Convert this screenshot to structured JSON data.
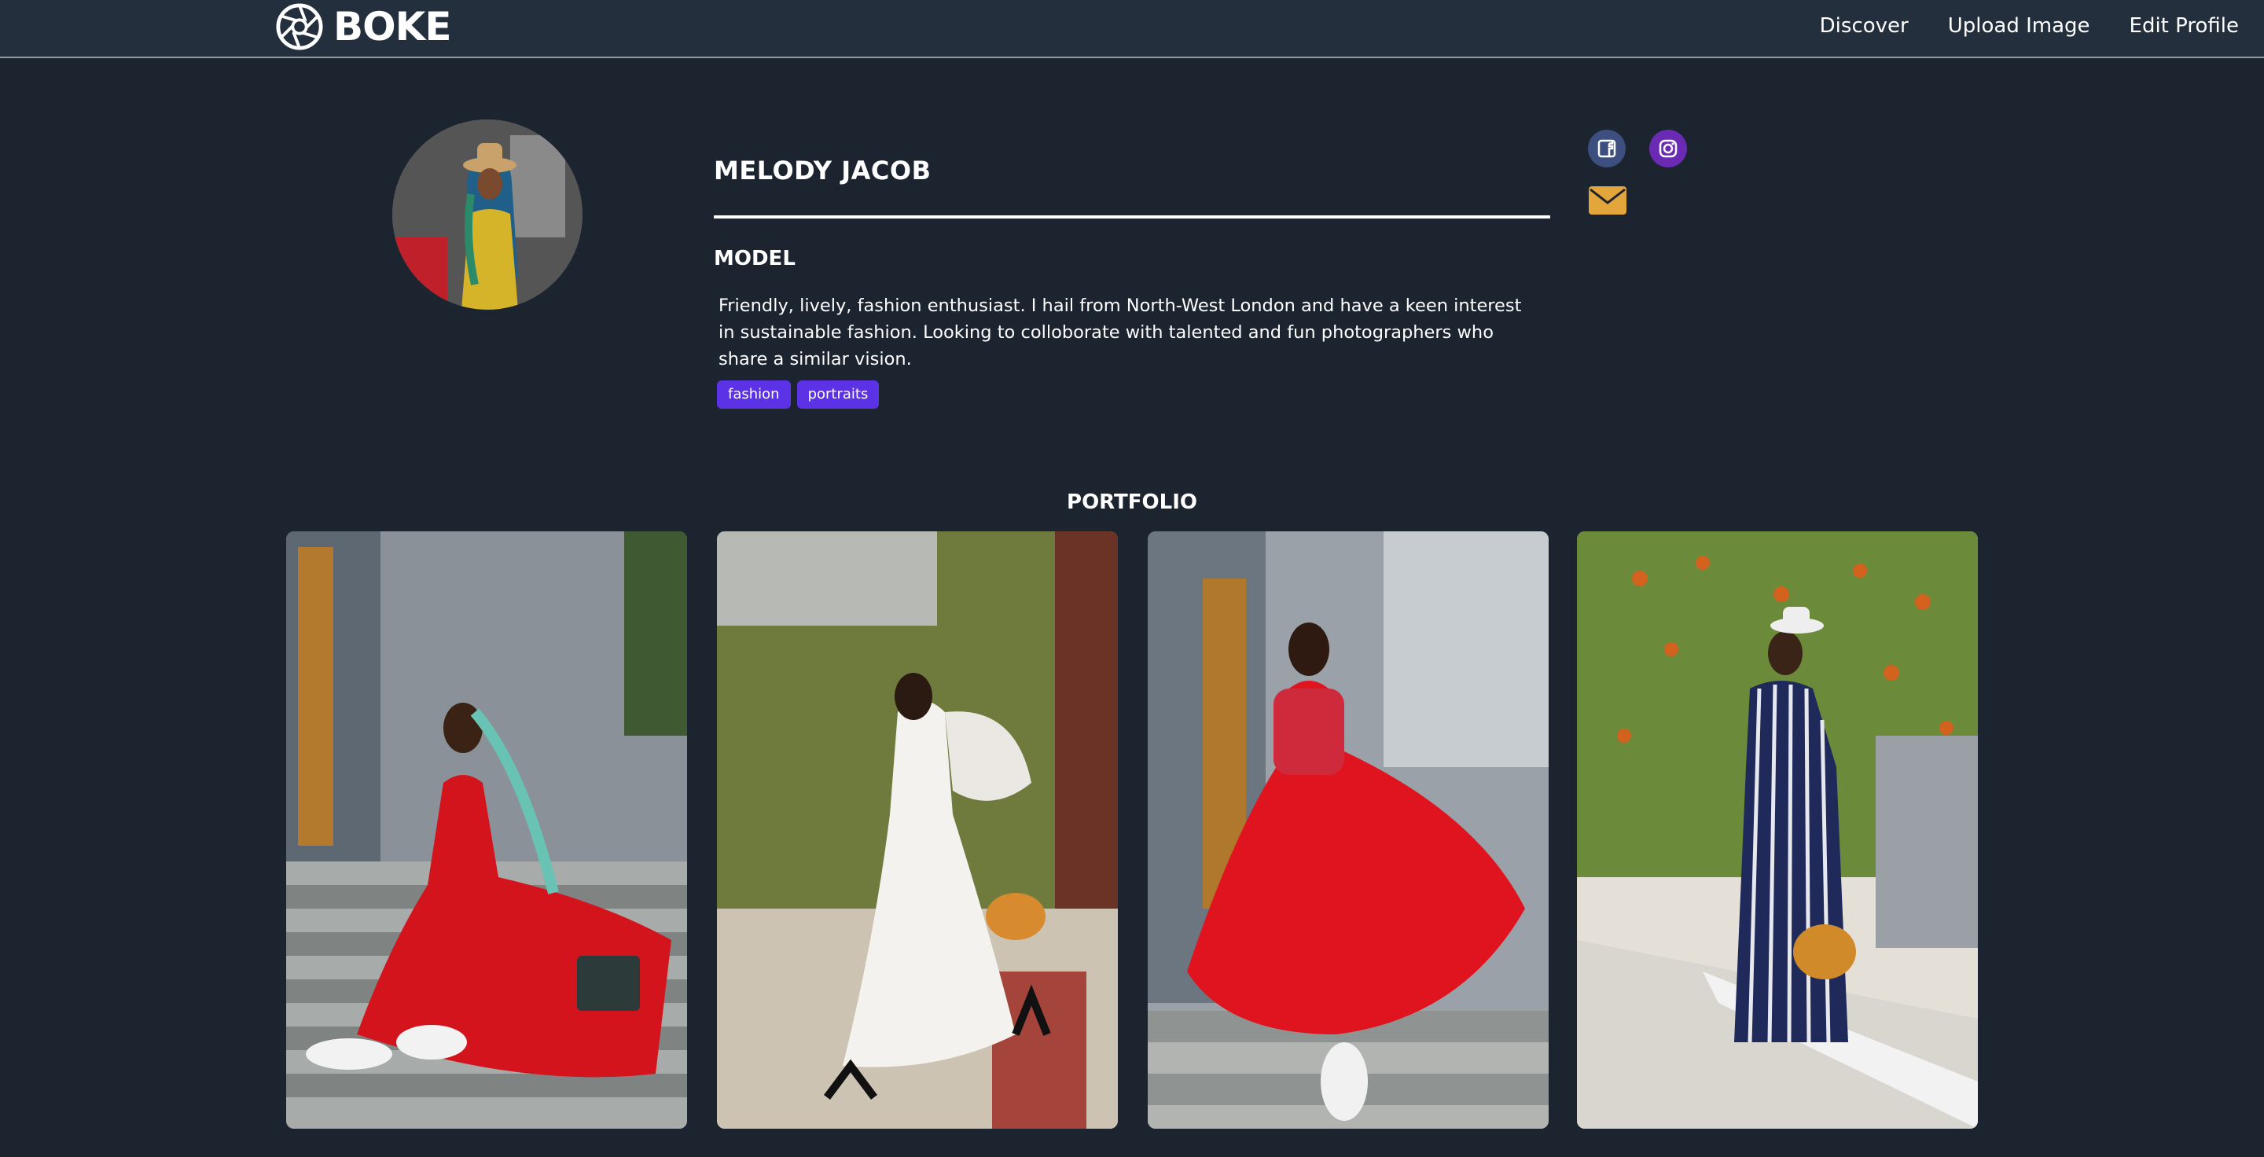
{
  "brand": {
    "name": "BOKE",
    "logo_icon": "aperture-icon"
  },
  "nav": {
    "links": [
      "Discover",
      "Upload Image",
      "Edit Profile"
    ]
  },
  "profile": {
    "name": "MELODY JACOB",
    "role": "MODEL",
    "bio": "Friendly, lively, fashion enthusiast. I hail from North-West London and have a keen interest in sustainable fashion. Looking to colloborate with talented and fun photographers who share a similar vision.",
    "tags": [
      "fashion",
      "portraits"
    ],
    "social": [
      {
        "icon": "facebook-icon",
        "color": "#3d4f7f"
      },
      {
        "icon": "instagram-icon",
        "color": "#6a2ab3"
      },
      {
        "icon": "envelope-icon",
        "color": "#e3a63a"
      }
    ]
  },
  "portfolio": {
    "title": "PORTFOLIO",
    "photo_count": 4
  },
  "colors": {
    "background": "#1c2430",
    "navbar": "#242f3d",
    "tag": "#5b32e5",
    "accent": "#e3a63a"
  }
}
